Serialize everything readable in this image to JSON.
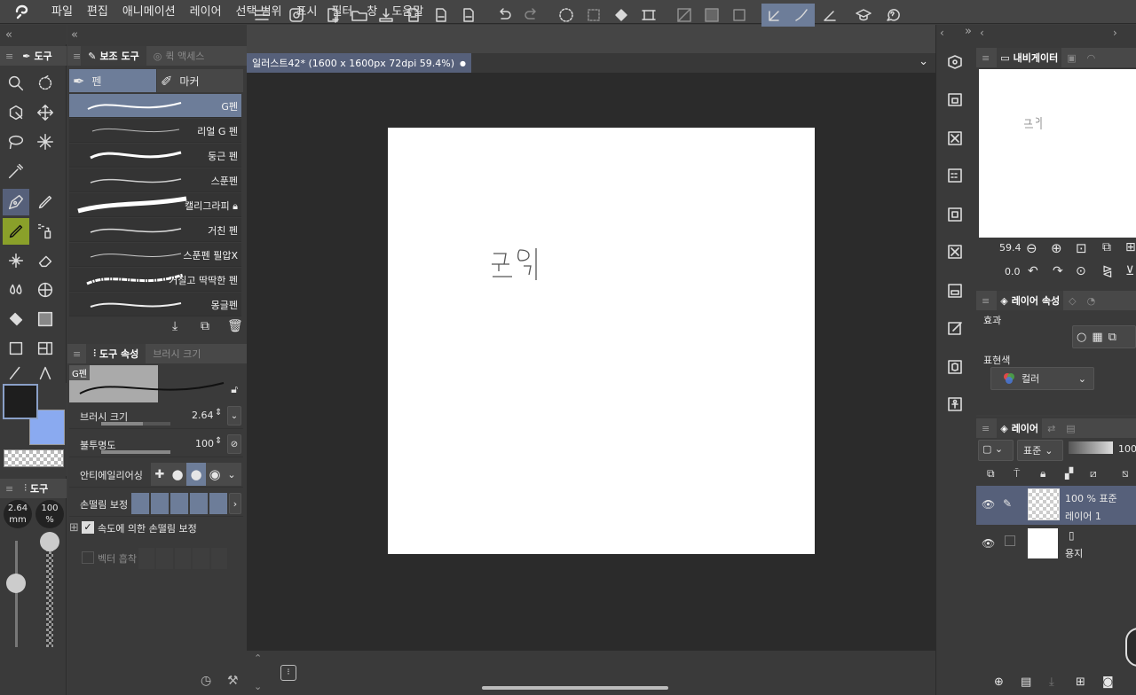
{
  "app": {
    "logo": "clip-studio-logo"
  },
  "menu": [
    "파일",
    "편집",
    "애니메이션",
    "레이어",
    "선택 범위",
    "표시",
    "필터",
    "창",
    "도움말"
  ],
  "panels": {
    "tool_tab": "도구",
    "subtool_tab": "보조 도구",
    "quick_access_tab": "퀵 액세스",
    "tool_property_tab": "도구 속성",
    "brush_size_tab": "브러시 크기",
    "color_tab": "도구"
  },
  "subtool_groups": {
    "pen": "펜",
    "marker": "마커"
  },
  "brushes": [
    {
      "label": "G펜",
      "selected": true
    },
    {
      "label": "리얼 G 펜"
    },
    {
      "label": "둥근 펜"
    },
    {
      "label": "스푼펜"
    },
    {
      "label": "캘리그라피",
      "locked": true
    },
    {
      "label": "거친 펜"
    },
    {
      "label": "스푼펜 필압X"
    },
    {
      "label": "거칠고 딱딱한 펜"
    },
    {
      "label": "몽글펜"
    }
  ],
  "tool_property": {
    "preview_label": "G펜",
    "brush_size_label": "브러시 크기",
    "brush_size_value": "2.64",
    "opacity_label": "불투명도",
    "opacity_value": "100",
    "antialias_label": "안티에일리어싱",
    "stabilization_label": "손떨림 보정",
    "speed_stabilization_label": "속도에 의한 손떨림 보정",
    "vector_snap_label": "벡터 흡착"
  },
  "brush_size_mini": {
    "size": "2.64",
    "unit": "mm",
    "opacity": "100",
    "opacity_unit": "%"
  },
  "document": {
    "tab_title": "일러스트42* (1600 x 1600px 72dpi 59.4%)",
    "canvas_text": "코믹"
  },
  "navigator": {
    "tab": "내비게이터",
    "zoom": "59.4",
    "rotation": "0.0",
    "preview_text": "코믹"
  },
  "layer_property": {
    "tab": "레이어 속성",
    "effect_label": "효과",
    "color_label": "표현색",
    "color_value": "컬러"
  },
  "layers_panel": {
    "tab": "레이어",
    "blend_mode": "표준",
    "opacity": "100",
    "layers": [
      {
        "line1": "100 % 표준",
        "line2": "레이어 1",
        "selected": true
      },
      {
        "line1": "",
        "line2": "용지",
        "selected": false
      }
    ]
  },
  "colors": {
    "main": "#1e1e1e",
    "sub": "#8aaaf0",
    "accent": "#6d7d99"
  }
}
